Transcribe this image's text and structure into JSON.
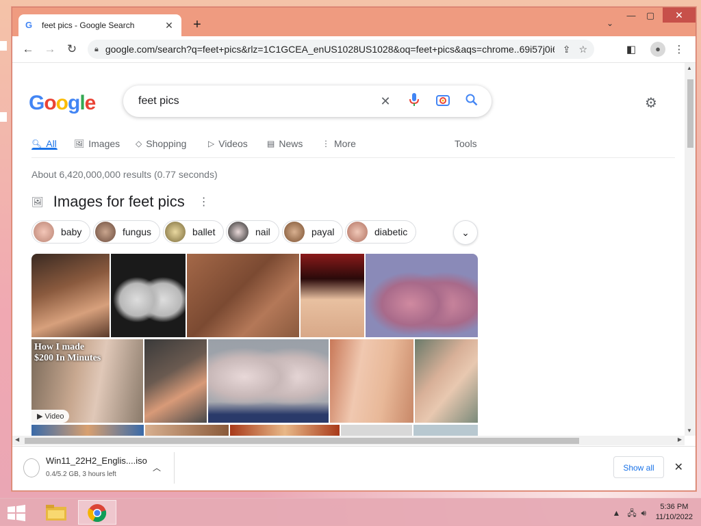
{
  "browser": {
    "tab_title": "feet pics - Google Search",
    "new_tab_label": "+",
    "url": "google.com/search?q=feet+pics&rlz=1C1GCEA_enUS1028US1028&oq=feet+pics&aqs=chrome..69i57j0i6..."
  },
  "google": {
    "logo": "Google",
    "query": "feet pics",
    "tabs": [
      {
        "label": "All",
        "icon": "search-icon"
      },
      {
        "label": "Images",
        "icon": "image-icon"
      },
      {
        "label": "Shopping",
        "icon": "tag-icon"
      },
      {
        "label": "Videos",
        "icon": "play-icon"
      },
      {
        "label": "News",
        "icon": "news-icon"
      },
      {
        "label": "More",
        "icon": "more-icon"
      }
    ],
    "tools_label": "Tools",
    "result_stats": "About 6,420,000,000 results (0.77 seconds)",
    "images_heading": "Images for feet pics",
    "chips": [
      "baby",
      "fungus",
      "ballet",
      "nail",
      "payal",
      "diabetic"
    ],
    "video_badge": "▶ Video",
    "thumb_overlay_line1": "How I made",
    "thumb_overlay_line2": "$200 In Minutes"
  },
  "download": {
    "filename": "Win11_22H2_Englis....iso",
    "status": "0.4/5.2 GB, 3 hours left",
    "show_all": "Show all"
  },
  "taskbar": {
    "time": "5:36 PM",
    "date": "11/10/2022"
  },
  "colors": {
    "accent_blue": "#1a73e8",
    "titlebar": "#ef9b80",
    "close_red": "#c7504a"
  }
}
